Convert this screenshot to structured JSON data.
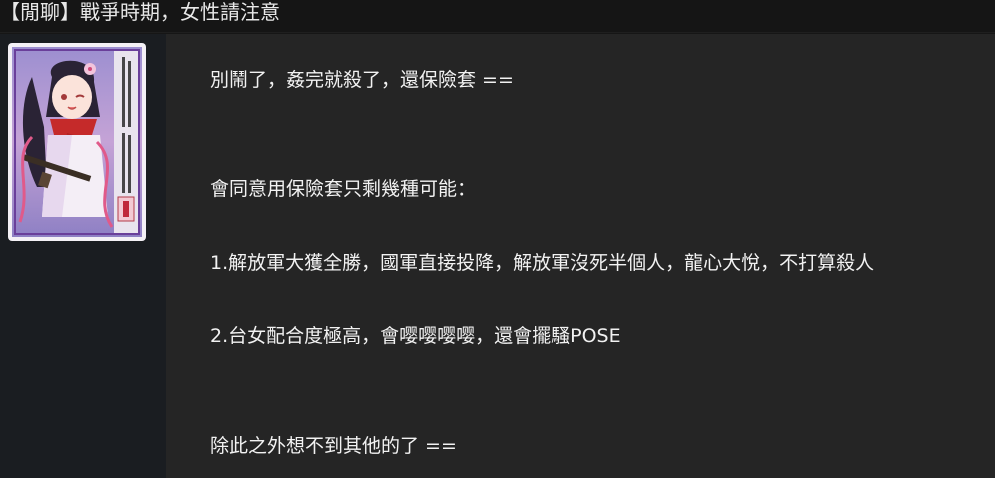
{
  "thread": {
    "title": "【閒聊】戰爭時期，女性請注意"
  },
  "author": {
    "avatar_icon": "anime-character-avatar",
    "avatar_calligraphy": [
      "吾心吾行澄如明鏡",
      "所作所為皆為",
      "正義"
    ]
  },
  "post": {
    "lines": [
      "別鬧了，姦完就殺了，還保險套 ==",
      "會同意用保險套只剩幾種可能：",
      "1.解放軍大獲全勝，國軍直接投降，解放軍沒死半個人，龍心大悅，不打算殺人",
      "2.台女配合度極高，會嘤嘤嘤嘤，還會擺騷POSE",
      "除此之外想不到其他的了 =="
    ]
  },
  "colors": {
    "background": "#161616",
    "content_panel": "#252525",
    "sidebar": "#1a1d21",
    "text": "#f2f2f2"
  }
}
